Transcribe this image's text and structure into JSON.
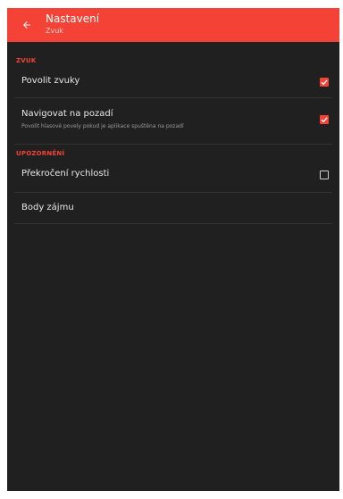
{
  "colors": {
    "accent": "#f44336",
    "background": "#202020",
    "text_primary": "#e8e8e8",
    "text_secondary": "#9a9a9a"
  },
  "appbar": {
    "back_icon": "arrow-back-icon",
    "title": "Nastavení",
    "subtitle": "Zvuk"
  },
  "sections": {
    "sound": {
      "header": "ZVUK",
      "items": [
        {
          "title": "Povolit zvuky",
          "checked": true
        },
        {
          "title": "Navigovat na pozadí",
          "summary": "Povolit hlasové povely pokud je aplikace spuštěna na pozadí",
          "checked": true
        }
      ]
    },
    "alerts": {
      "header": "UPOZORNĚNÍ",
      "items": [
        {
          "title": "Překročení rychlosti",
          "checked": false
        },
        {
          "title": "Body zájmu"
        }
      ]
    }
  }
}
